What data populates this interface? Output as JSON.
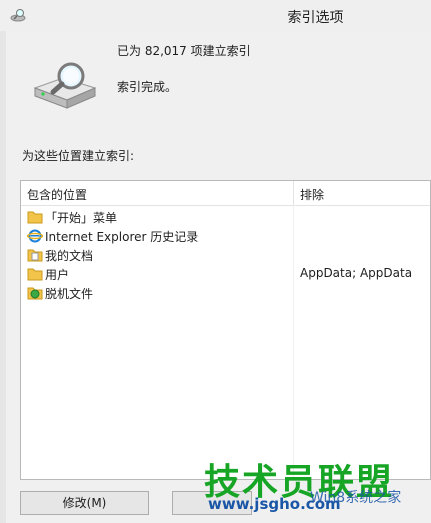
{
  "window": {
    "title": "索引选项"
  },
  "status": {
    "count_text": "已为 82,017 项建立索引",
    "done_text": "索引完成。"
  },
  "section_label": "为这些位置建立索引:",
  "list": {
    "columns": [
      "包含的位置",
      "排除"
    ],
    "rows": [
      {
        "icon": "folder-icon",
        "name": "「开始」菜单",
        "excluded": ""
      },
      {
        "icon": "internet-explorer-icon",
        "name": "Internet Explorer 历史记录",
        "excluded": ""
      },
      {
        "icon": "documents-folder-icon",
        "name": "我的文档",
        "excluded": ""
      },
      {
        "icon": "folder-icon",
        "name": "用户",
        "excluded": "AppData; AppData"
      },
      {
        "icon": "offline-files-icon",
        "name": "脱机文件",
        "excluded": ""
      }
    ]
  },
  "buttons": {
    "modify": "修改(M)"
  },
  "watermark": {
    "brand": "技术员联盟",
    "url": "www.jsgho.com",
    "logo_text": "Win8系统之家"
  }
}
